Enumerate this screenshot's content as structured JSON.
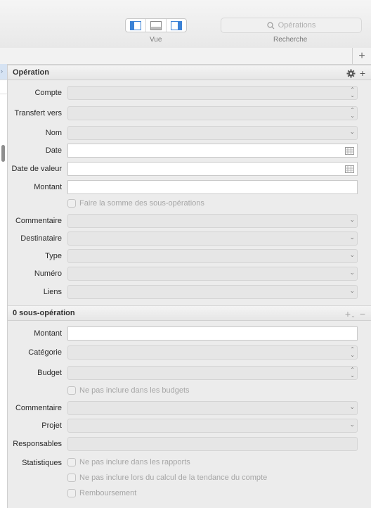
{
  "toolbar": {
    "view_label": "Vue",
    "search_label": "Recherche",
    "search_placeholder": "Opérations"
  },
  "operation": {
    "title": "Opération",
    "fields": {
      "compte": "Compte",
      "transfert": "Transfert vers",
      "nom": "Nom",
      "date": "Date",
      "date_valeur": "Date de valeur",
      "montant": "Montant",
      "somme_checkbox": "Faire la somme des sous-opérations",
      "commentaire": "Commentaire",
      "destinataire": "Destinataire",
      "type": "Type",
      "numero": "Numéro",
      "liens": "Liens"
    }
  },
  "sub_operation": {
    "title": "0 sous-opération",
    "fields": {
      "montant": "Montant",
      "categorie": "Catégorie",
      "budget": "Budget",
      "exclude_budget": "Ne pas inclure dans les budgets",
      "commentaire": "Commentaire",
      "projet": "Projet",
      "responsables": "Responsables",
      "statistiques": "Statistiques",
      "exclude_reports": "Ne pas inclure dans les rapports",
      "exclude_trend": "Ne pas inclure lors du calcul de la tendance du compte",
      "remboursement": "Remboursement"
    }
  },
  "colors": {
    "accent": "#3b82d6",
    "panel": "#ececec"
  }
}
